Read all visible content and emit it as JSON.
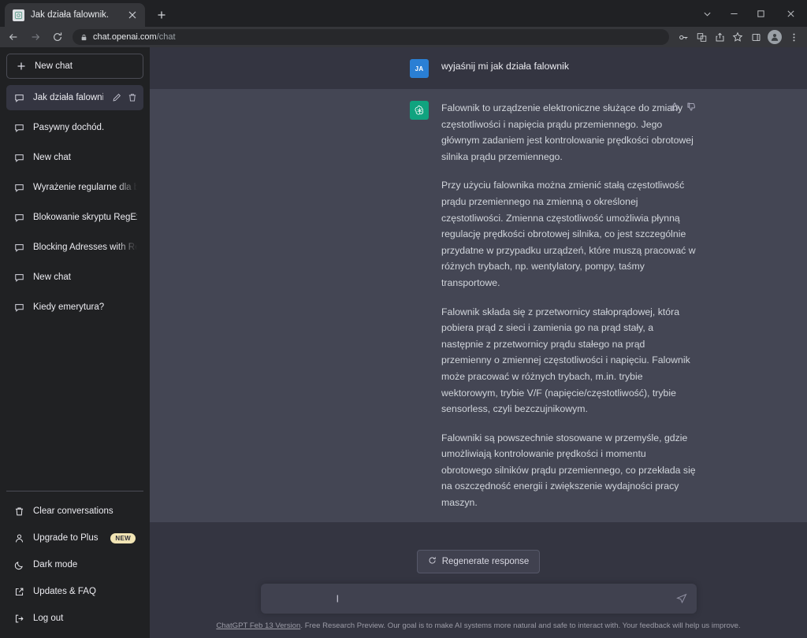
{
  "browser": {
    "tab": {
      "title": "Jak działa falownik.",
      "favicon_icon": "page-icon",
      "close_icon": "close-icon"
    },
    "new_tab_icon": "plus-icon",
    "window_controls": [
      {
        "name": "chevron-down-icon",
        "glyph": "⌄"
      },
      {
        "name": "minimize-icon",
        "glyph": "—"
      },
      {
        "name": "maximize-icon",
        "glyph": "▢"
      },
      {
        "name": "close-icon",
        "glyph": "✕"
      }
    ],
    "nav": {
      "back_icon": "back-arrow-icon",
      "forward_icon": "forward-arrow-icon",
      "reload_icon": "reload-icon"
    },
    "omnibox": {
      "lock_icon": "lock-icon",
      "url_host": "chat.openai.com",
      "url_path": "/chat"
    },
    "toolbar_icons": [
      "key-icon",
      "translate-icon",
      "share-icon",
      "bookmark-star-icon",
      "side-panel-icon",
      "profile-avatar-icon",
      "more-menu-icon"
    ]
  },
  "sidebar": {
    "new_chat": {
      "label": "New chat",
      "icon": "plus-icon"
    },
    "chats": [
      {
        "label": "Jak działa falownik.",
        "icon": "chat-bubble-icon",
        "active": true,
        "edit_icon": "pencil-icon",
        "delete_icon": "trash-icon"
      },
      {
        "label": "Pasywny dochód.",
        "icon": "chat-bubble-icon",
        "active": false
      },
      {
        "label": "New chat",
        "icon": "chat-bubble-icon",
        "active": false
      },
      {
        "label": "Wyrażenie regularne dla bloka",
        "icon": "chat-bubble-icon",
        "active": false,
        "truncated": true
      },
      {
        "label": "Blokowanie skryptu RegEx",
        "icon": "chat-bubble-icon",
        "active": false
      },
      {
        "label": "Blocking Adresses with RegEx",
        "icon": "chat-bubble-icon",
        "active": false,
        "truncated": true
      },
      {
        "label": "New chat",
        "icon": "chat-bubble-icon",
        "active": false
      },
      {
        "label": "Kiedy emerytura?",
        "icon": "chat-bubble-icon",
        "active": false
      }
    ],
    "menu": [
      {
        "label": "Clear conversations",
        "icon": "trash-icon"
      },
      {
        "label": "Upgrade to Plus",
        "icon": "person-icon",
        "badge": "NEW"
      },
      {
        "label": "Dark mode",
        "icon": "moon-icon"
      },
      {
        "label": "Updates & FAQ",
        "icon": "external-link-icon"
      },
      {
        "label": "Log out",
        "icon": "logout-icon"
      }
    ]
  },
  "conversation": {
    "user": {
      "avatar_initials": "JA",
      "avatar_color": "#2a7fd4",
      "text": "wyjaśnij mi jak działa falownik"
    },
    "assistant": {
      "avatar_icon": "chatgpt-logo-icon",
      "avatar_color": "#10a37f",
      "thumbs_up_icon": "thumbs-up-icon",
      "thumbs_down_icon": "thumbs-down-icon",
      "paragraphs": [
        "Falownik to urządzenie elektroniczne służące do zmiany częstotliwości i napięcia prądu przemiennego. Jego głównym zadaniem jest kontrolowanie prędkości obrotowej silnika prądu przemiennego.",
        "Przy użyciu falownika można zmienić stałą częstotliwość prądu przemiennego na zmienną o określonej częstotliwości. Zmienna częstotliwość umożliwia płynną regulację prędkości obrotowej silnika, co jest szczególnie przydatne w przypadku urządzeń, które muszą pracować w różnych trybach, np. wentylatory, pompy, taśmy transportowe.",
        "Falownik składa się z przetwornicy stałoprądowej, która pobiera prąd z sieci i zamienia go na prąd stały, a następnie z przetwornicy prądu stałego na prąd przemienny o zmiennej częstotliwości i napięciu. Falownik może pracować w różnych trybach, m.in. trybie wektorowym, trybie V/F (napięcie/częstotliwość), trybie sensorless, czyli bezczujnikowym.",
        "Falowniki są powszechnie stosowane w przemyśle, gdzie umożliwiają kontrolowanie prędkości i momentu obrotowego silników prądu przemiennego, co przekłada się na oszczędność energii i zwiększenie wydajności pracy maszyn."
      ]
    }
  },
  "composer": {
    "regenerate": {
      "label": "Regenerate response",
      "icon": "refresh-icon"
    },
    "input_value": "",
    "input_placeholder": "",
    "send_icon": "send-plane-icon",
    "footer_link": "ChatGPT Feb 13 Version",
    "footer_text": ". Free Research Preview. Our goal is to make AI systems more natural and safe to interact with. Your feedback will help us improve."
  }
}
